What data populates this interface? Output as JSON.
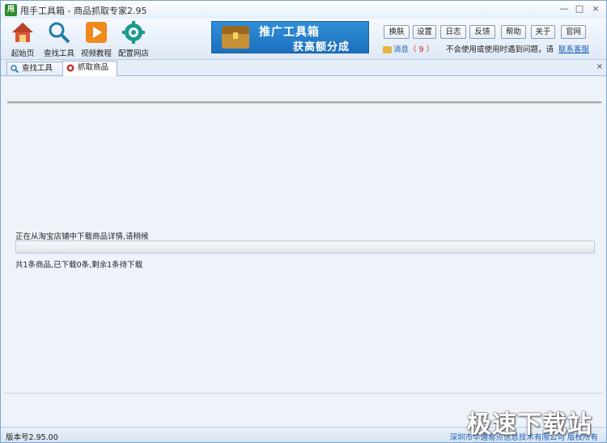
{
  "window": {
    "icon_text": "甩",
    "title": "甩手工具箱 - 商品抓取专家2.95",
    "minimize": "—",
    "maximize": "□",
    "close": "×"
  },
  "toolbar": {
    "buttons": [
      {
        "label": "起始页",
        "icon": "home-icon"
      },
      {
        "label": "查找工具",
        "icon": "search-icon"
      },
      {
        "label": "视频教程",
        "icon": "video-play-icon"
      },
      {
        "label": "配置网店",
        "icon": "settings-gear-icon"
      }
    ],
    "banner": {
      "line1": "推广工具箱",
      "line2": "获高额分成"
    },
    "small_buttons": [
      "换肤",
      "设置",
      "日志",
      "反馈",
      "帮助",
      "关于",
      "官网"
    ],
    "message_label": "消息",
    "message_count": "（ 9 ）",
    "help_text": "不会使用或使用时遇到问题，请",
    "help_link": "联系客服"
  },
  "tabs": [
    {
      "label": "查找工具",
      "icon": "search-icon",
      "active": false
    },
    {
      "label": "抓取商品",
      "icon": "grab-icon",
      "active": true
    }
  ],
  "tab_close": "×",
  "content": {
    "status_top": "正在从淘宝店铺中下载商品详情,请稍候",
    "progress": 0,
    "status_bottom": "共1条商品,已下载0条,剩余1条待下载"
  },
  "statusbar": {
    "version": "版本号2.95.00",
    "company": "深圳市华通易点信息技术有限公司 版权所有"
  },
  "watermark": "极速下载站",
  "colors": {
    "accent": "#1a5fb4",
    "banner": "#1c6fbe",
    "progress_fill": "#3fae3f"
  }
}
